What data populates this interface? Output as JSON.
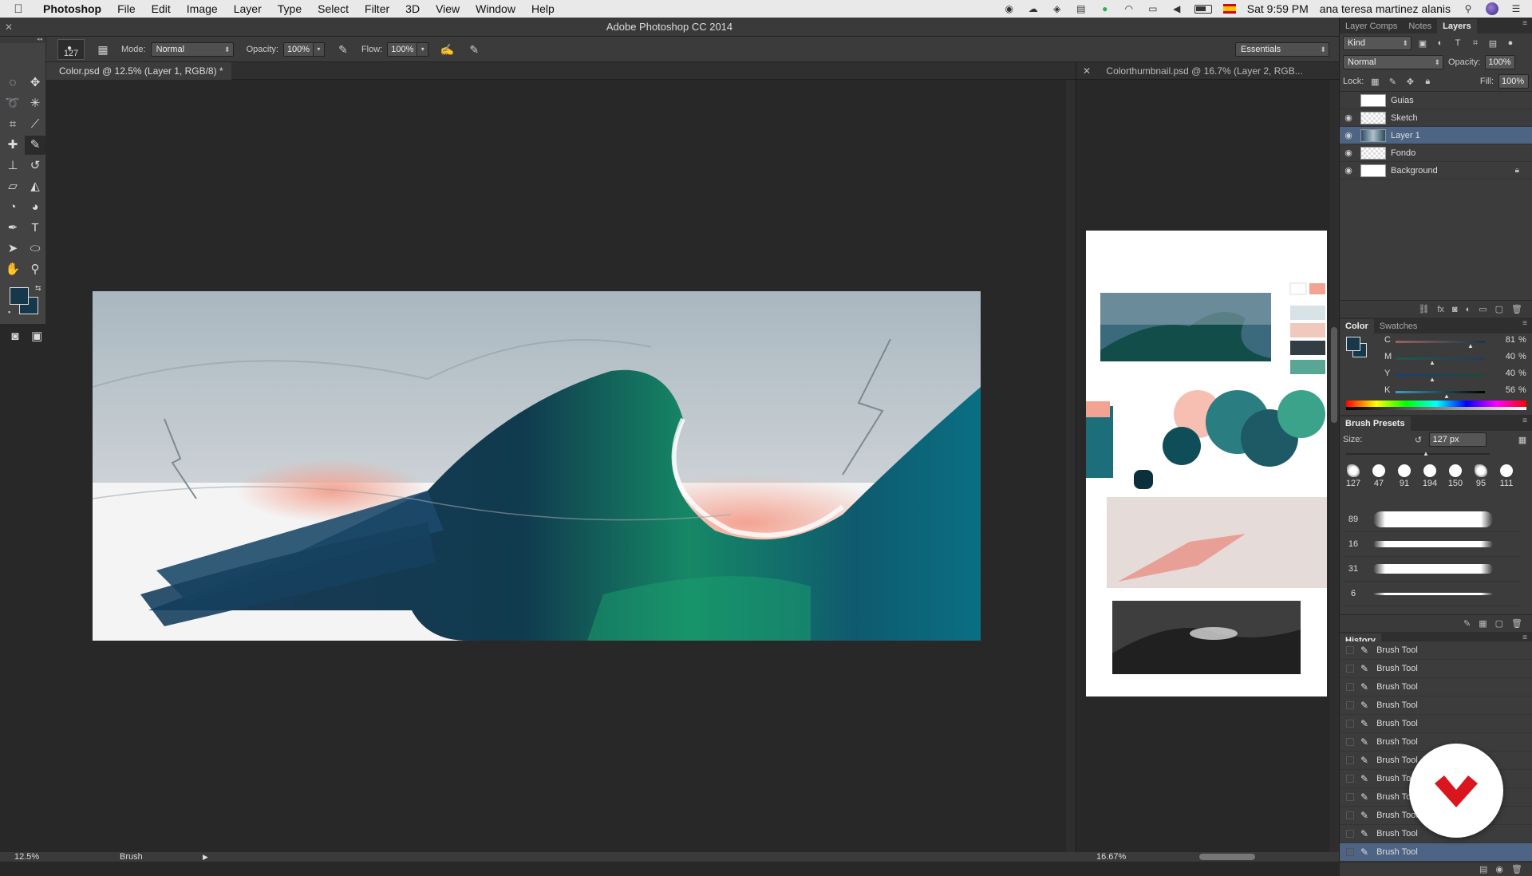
{
  "menubar": {
    "app_name": "Photoshop",
    "items": [
      "File",
      "Edit",
      "Image",
      "Layer",
      "Type",
      "Select",
      "Filter",
      "3D",
      "View",
      "Window",
      "Help"
    ],
    "clock": "Sat 9:59 PM",
    "user": "ana teresa martinez alanis"
  },
  "window": {
    "title": "Adobe Photoshop CC 2014"
  },
  "options": {
    "brush_size": "127",
    "mode_label": "Mode:",
    "mode_value": "Normal",
    "opacity_label": "Opacity:",
    "opacity_value": "100%",
    "flow_label": "Flow:",
    "flow_value": "100%",
    "workspace": "Essentials"
  },
  "toolbox": {
    "foreground_color": "#17384a",
    "background_color": "#17384a"
  },
  "documents": {
    "left_tab": "Color.psd @ 12.5% (Layer 1, RGB/8) *",
    "right_tab": "Colorthumbnail.psd @ 16.7% (Layer 2, RGB..."
  },
  "status": {
    "left_zoom": "12.5%",
    "left_info": "Brush",
    "right_zoom": "16.67%"
  },
  "layers_panel": {
    "tabs": [
      "Layer Comps",
      "Notes",
      "Layers"
    ],
    "filter": "Kind",
    "blend_mode": "Normal",
    "opacity_label": "Opacity:",
    "opacity": "100%",
    "lock_label": "Lock:",
    "fill_label": "Fill:",
    "fill": "100%",
    "layers": [
      {
        "name": "Guias",
        "visible": false
      },
      {
        "name": "Sketch",
        "visible": true
      },
      {
        "name": "Layer 1",
        "visible": true,
        "selected": true
      },
      {
        "name": "Fondo",
        "visible": true
      },
      {
        "name": "Background",
        "visible": true,
        "locked": true
      }
    ]
  },
  "color_panel": {
    "tabs": [
      "Color",
      "Swatches"
    ],
    "channels": [
      {
        "label": "C",
        "value": "81",
        "unit": "%"
      },
      {
        "label": "M",
        "value": "40",
        "unit": "%"
      },
      {
        "label": "Y",
        "value": "40",
        "unit": "%"
      },
      {
        "label": "K",
        "value": "56",
        "unit": "%"
      }
    ]
  },
  "brush_presets": {
    "title": "Brush Presets",
    "size_label": "Size:",
    "size_value": "127 px",
    "tips": [
      "127",
      "47",
      "91",
      "194",
      "150",
      "95",
      "111"
    ],
    "strokes": [
      "89",
      "16",
      "31",
      "6"
    ]
  },
  "history": {
    "title": "History",
    "items": [
      "Brush Tool",
      "Brush Tool",
      "Brush Tool",
      "Brush Tool",
      "Brush Tool",
      "Brush Tool",
      "Brush Tool",
      "Brush Tool",
      "Brush Tool",
      "Brush Tool",
      "Brush Tool",
      "Brush Tool"
    ]
  }
}
